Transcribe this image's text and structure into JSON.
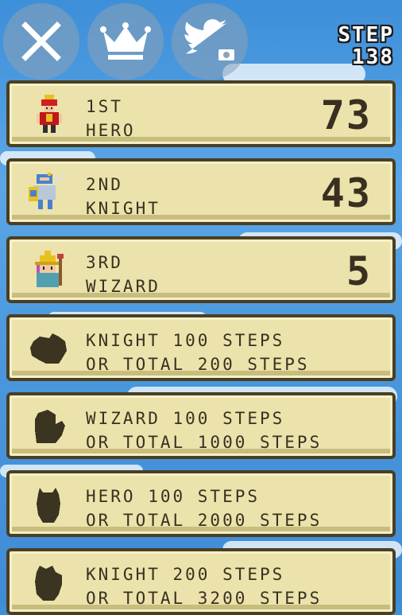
{
  "toolbar": {
    "close_icon": "close-x-icon",
    "ranking_icon": "crown-icon",
    "share_icon": "twitter-camera-icon"
  },
  "step": {
    "label": "STEP",
    "value": "138"
  },
  "characters": [
    {
      "line1": "1ST",
      "line2": "HERO",
      "count": "73",
      "sprite": "hero-sprite"
    },
    {
      "line1": "2ND",
      "line2": "KNIGHT",
      "count": "43",
      "sprite": "knight-sprite"
    },
    {
      "line1": "3RD",
      "line2": "WIZARD",
      "count": "5",
      "sprite": "wizard-sprite"
    }
  ],
  "locked": [
    {
      "line1": "KNIGHT 100 STEPS",
      "line2": "OR TOTAL 200 STEPS"
    },
    {
      "line1": "WIZARD 100 STEPS",
      "line2": "OR TOTAL 1000 STEPS"
    },
    {
      "line1": "HERO 100 STEPS",
      "line2": "OR TOTAL 2000 STEPS"
    },
    {
      "line1": "KNIGHT 200 STEPS",
      "line2": "OR TOTAL 3200 STEPS"
    }
  ],
  "colors": {
    "card_bg": "#ebe3ab",
    "card_border": "#4a3f22",
    "text": "#3a3020",
    "silhouette": "#3a3420"
  }
}
